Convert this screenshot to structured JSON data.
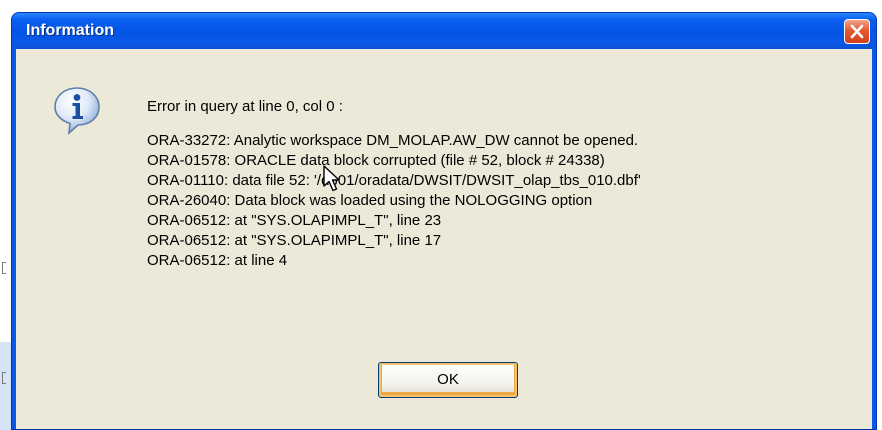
{
  "dialog": {
    "title": "Information",
    "icon": "info-icon",
    "close_icon": "close-icon",
    "message": {
      "first_line": "Error in query at line 0, col 0 :",
      "lines": [
        "ORA-33272: Analytic workspace DM_MOLAP.AW_DW cannot be opened.",
        "ORA-01578: ORACLE data block corrupted (file # 52, block # 24338)",
        "ORA-01110: data file 52: '/db01/oradata/DWSIT/DWSIT_olap_tbs_010.dbf'",
        "ORA-26040: Data block was loaded using the NOLOGGING option",
        "ORA-06512: at \"SYS.OLAPIMPL_T\", line 23",
        "ORA-06512: at \"SYS.OLAPIMPL_T\", line 17",
        "ORA-06512: at line 4"
      ]
    },
    "ok_label": "OK"
  },
  "colors": {
    "titlebar": "#0a58e6",
    "client": "#ece9d8",
    "close_button": "#e25a32",
    "ok_focus": "#f7c168"
  }
}
